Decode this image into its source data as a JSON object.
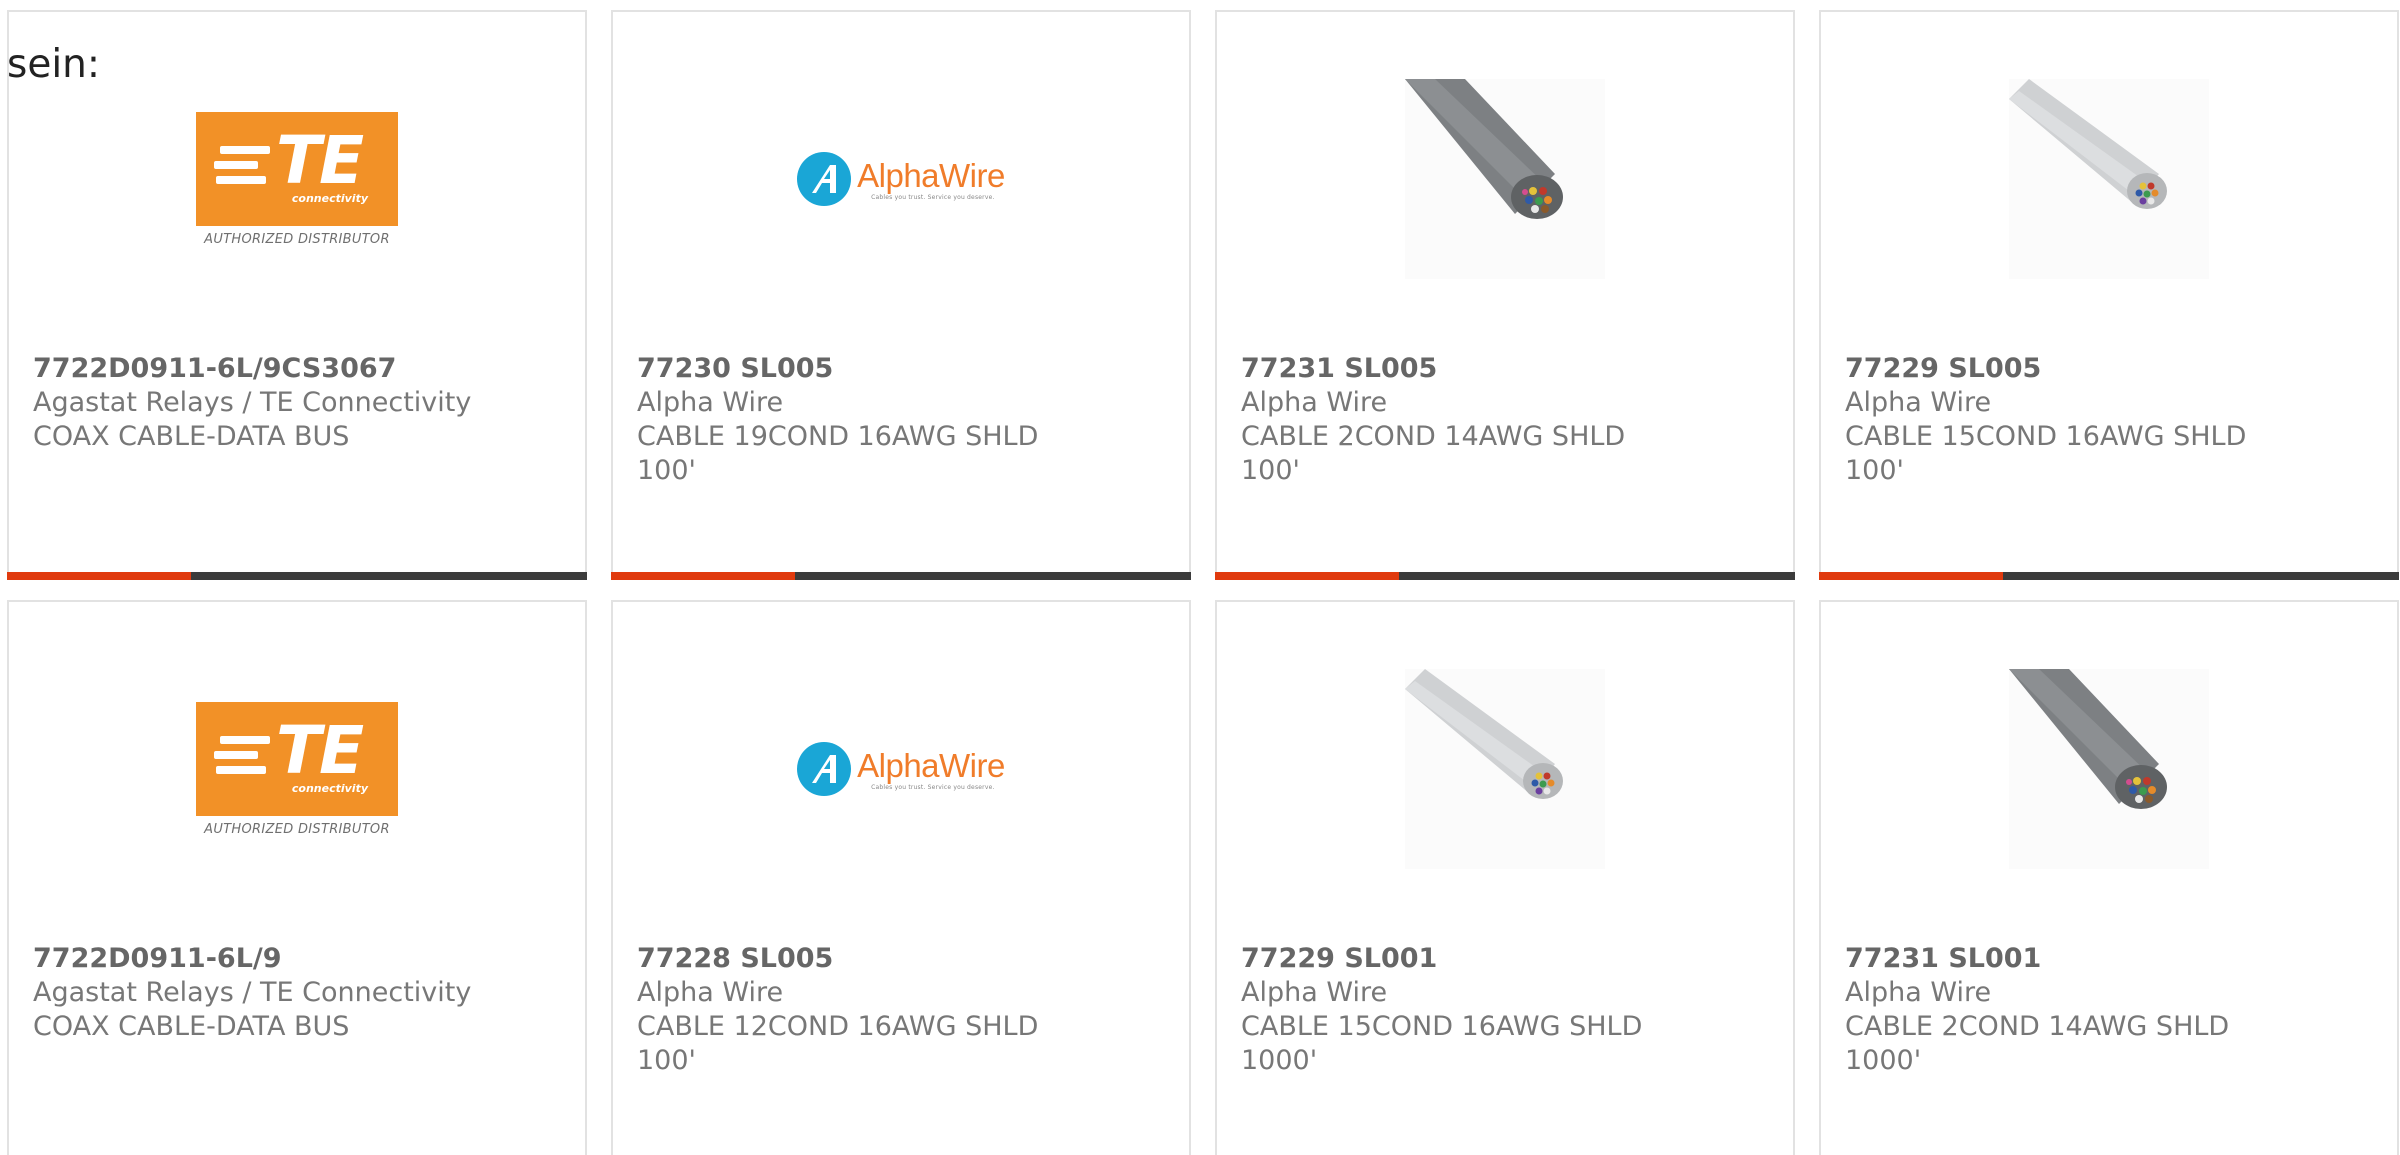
{
  "intro_text": "sein:",
  "colors": {
    "accent_bar": "#e03a0e",
    "bar_rest": "#3b3b3b",
    "te_orange": "#f29127",
    "alphawire_blue": "#1aa6d6",
    "alphawire_orange": "#f07c2a"
  },
  "logos": {
    "te": {
      "letters": "TE",
      "sub": "connectivity",
      "distributor": "AUTHORIZED DISTRIBUTOR"
    },
    "alphawire": {
      "name": "AlphaWire",
      "tagline": "Cables you trust. Service you deserve."
    }
  },
  "products": [
    {
      "part_number": "7722D0911-6L/9CS3067",
      "manufacturer": "Agastat Relays / TE Connectivity",
      "description": "COAX CABLE-DATA BUS",
      "image": "te-logo"
    },
    {
      "part_number": "77230 SL005",
      "manufacturer": "Alpha Wire",
      "description": "CABLE 19COND 16AWG SHLD 100'",
      "image": "alphawire-logo"
    },
    {
      "part_number": "77231 SL005",
      "manufacturer": "Alpha Wire",
      "description": "CABLE 2COND 14AWG SHLD 100'",
      "image": "cable-dark"
    },
    {
      "part_number": "77229 SL005",
      "manufacturer": "Alpha Wire",
      "description": "CABLE 15COND 16AWG SHLD 100'",
      "image": "cable-light"
    },
    {
      "part_number": "7722D0911-6L/9",
      "manufacturer": "Agastat Relays / TE Connectivity",
      "description": "COAX CABLE-DATA BUS",
      "image": "te-logo"
    },
    {
      "part_number": "77228 SL005",
      "manufacturer": "Alpha Wire",
      "description": "CABLE 12COND 16AWG SHLD 100'",
      "image": "alphawire-logo"
    },
    {
      "part_number": "77229 SL001",
      "manufacturer": "Alpha Wire",
      "description": "CABLE 15COND 16AWG SHLD 1000'",
      "image": "cable-light"
    },
    {
      "part_number": "77231 SL001",
      "manufacturer": "Alpha Wire",
      "description": "CABLE 2COND 14AWG SHLD 1000'",
      "image": "cable-dark"
    }
  ]
}
